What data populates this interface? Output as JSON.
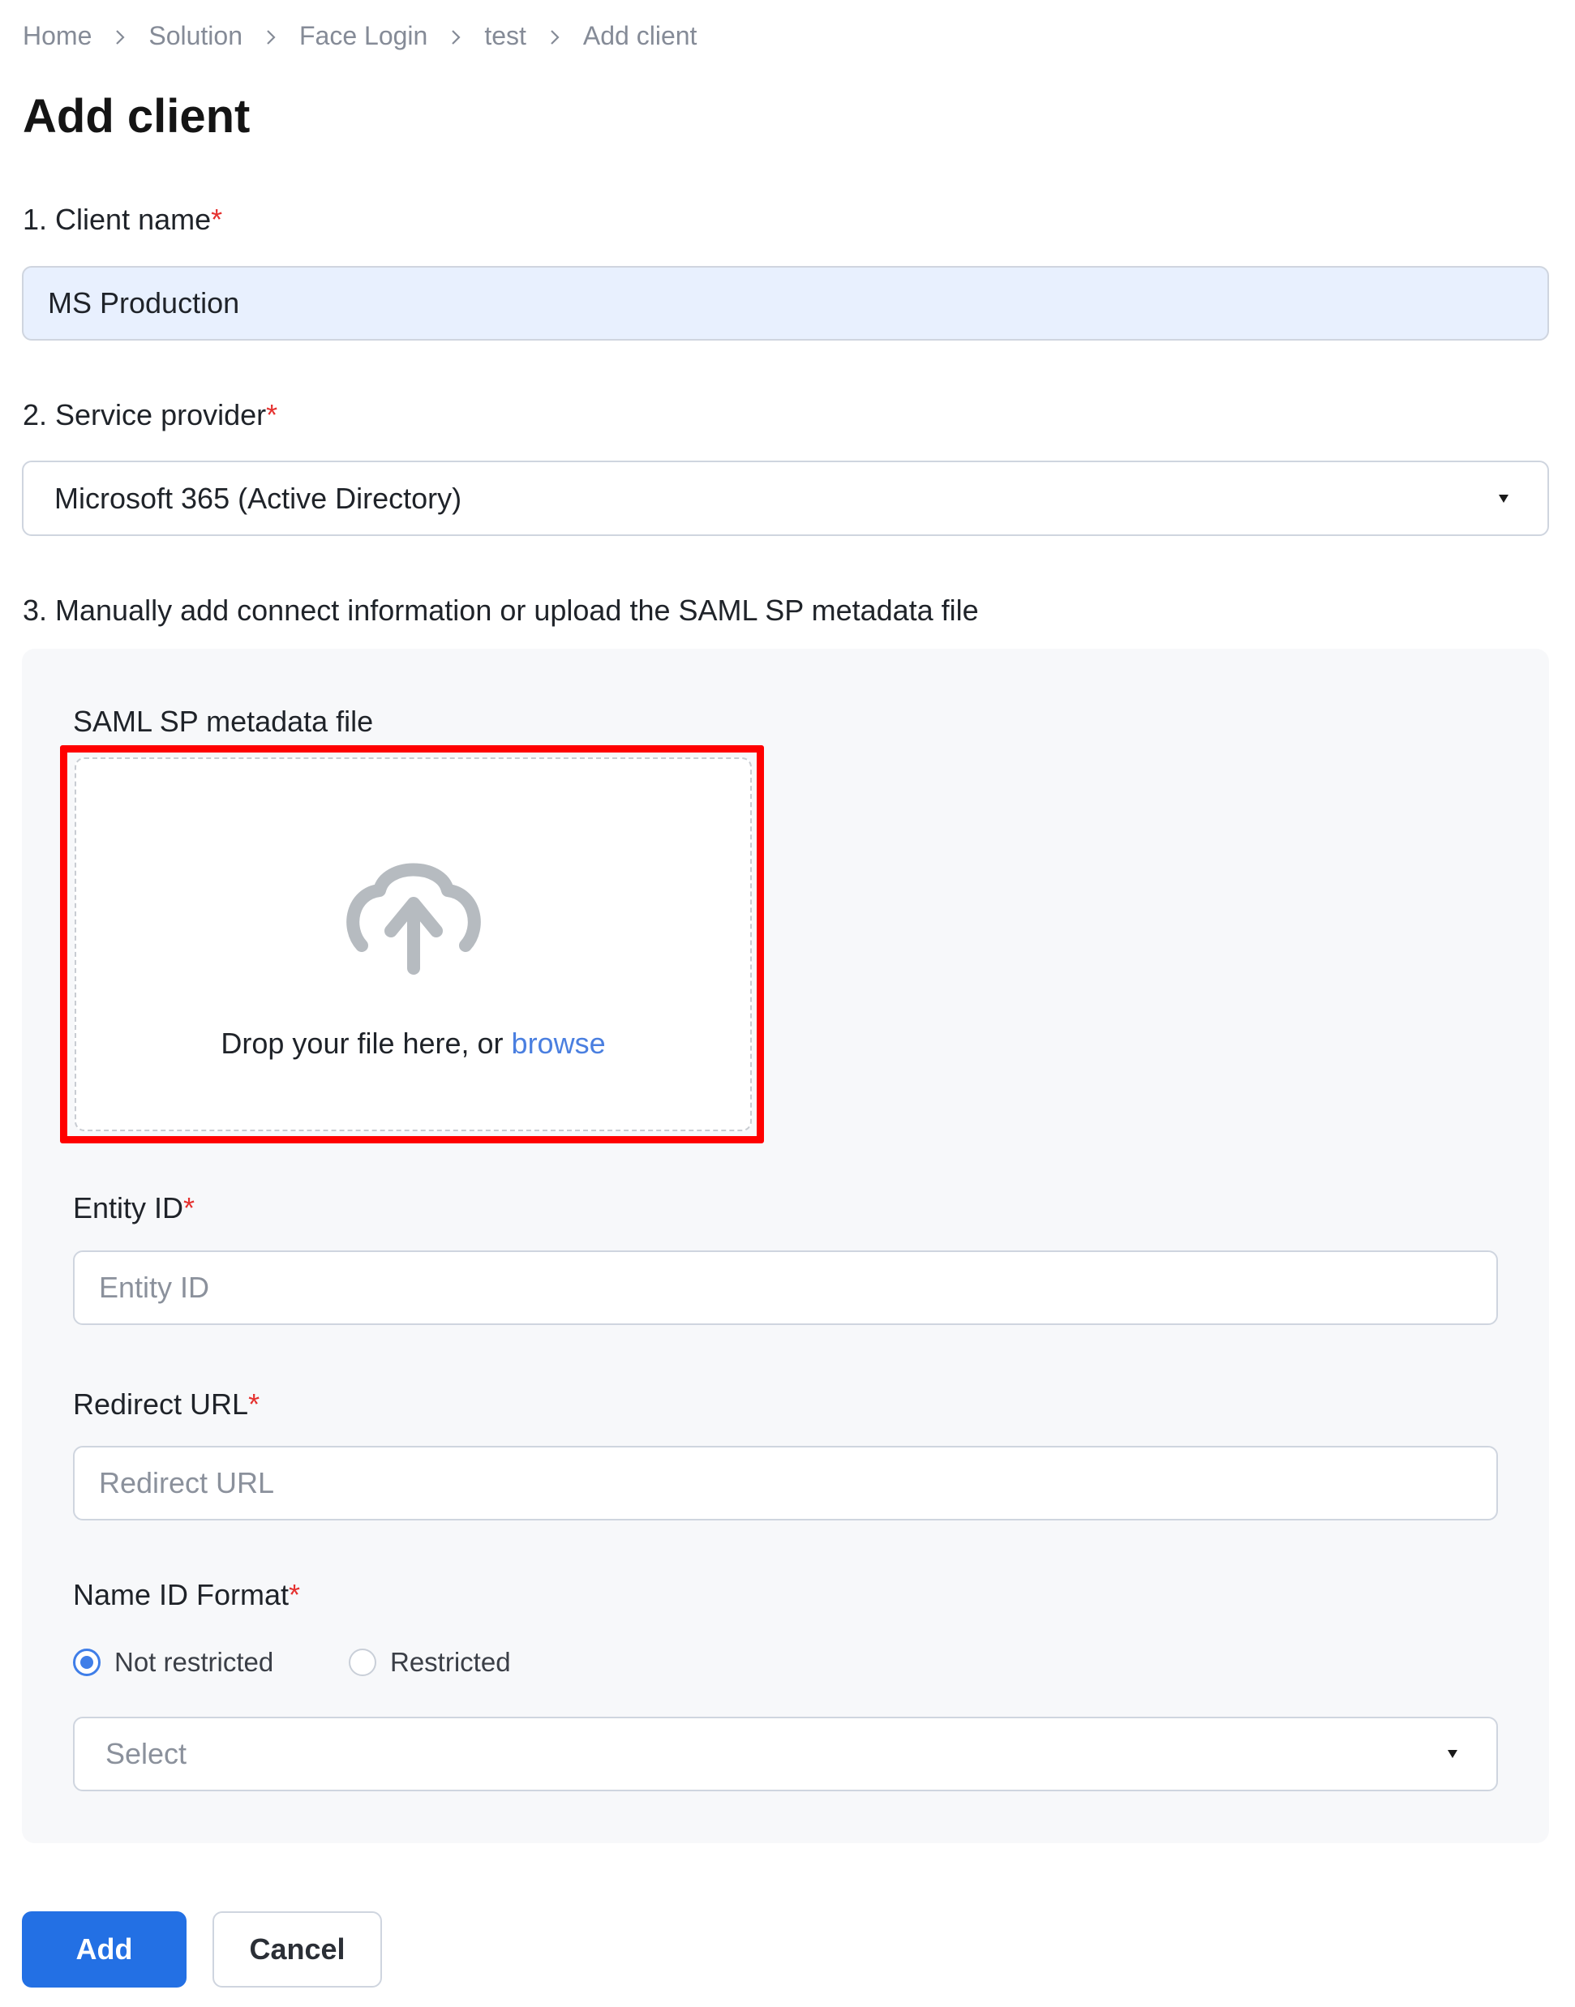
{
  "breadcrumb": {
    "items": [
      "Home",
      "Solution",
      "Face Login",
      "test",
      "Add client"
    ]
  },
  "page": {
    "title": "Add client"
  },
  "form": {
    "client_name": {
      "label": "1. Client name",
      "required_mark": "*",
      "value": "MS Production"
    },
    "service_provider": {
      "label": "2. Service provider",
      "required_mark": "*",
      "selected": "Microsoft 365 (Active Directory)"
    },
    "connect_info": {
      "label": "3. Manually add connect information or upload the SAML SP metadata file",
      "metadata_file": {
        "label": "SAML SP metadata file",
        "drop_text": "Drop your file here, or ",
        "browse_link": "browse",
        "icon": "cloud-upload-icon"
      },
      "entity_id": {
        "label": "Entity ID",
        "required_mark": "*",
        "value": "",
        "placeholder": "Entity ID"
      },
      "redirect_url": {
        "label": "Redirect URL",
        "required_mark": "*",
        "value": "",
        "placeholder": "Redirect URL"
      },
      "name_id_format": {
        "label": "Name ID Format",
        "required_mark": "*",
        "options": [
          {
            "label": "Not restricted",
            "checked": true
          },
          {
            "label": "Restricted",
            "checked": false
          }
        ],
        "select_placeholder": "Select"
      }
    }
  },
  "actions": {
    "add_label": "Add",
    "cancel_label": "Cancel"
  },
  "colors": {
    "accent": "#2370e4",
    "required": "#e5312f",
    "highlight_box": "#ff0000",
    "link": "#4a7fe0"
  }
}
